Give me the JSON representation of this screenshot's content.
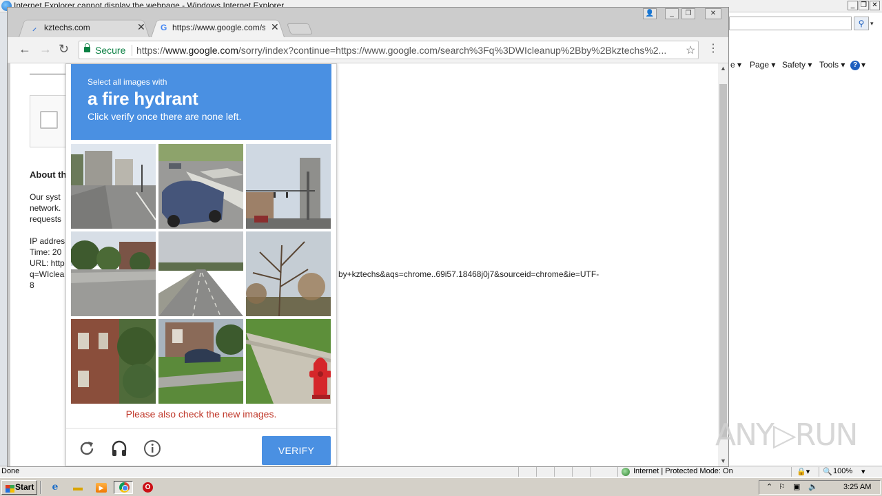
{
  "ie": {
    "title": "Internet Explorer cannot display the webpage - Windows Internet Explorer",
    "menu": {
      "page": "Page ▾",
      "safety": "Safety ▾",
      "tools": "Tools ▾",
      "help_glyph": "?"
    },
    "status": {
      "left": "Done",
      "zone": "Internet | Protected Mode: On",
      "zoom": "100%"
    }
  },
  "chrome": {
    "tabs": [
      {
        "label": "kztechs.com",
        "favicon": "feather-icon"
      },
      {
        "label": "https://www.google.com/se",
        "favicon": "google-g-icon"
      }
    ],
    "omnibox": {
      "secure": "Secure",
      "url_prefix": "https://",
      "url_host": "www.google.com",
      "url_rest": "/sorry/index?continue=https://www.google.com/search%3Fq%3DWIcleanup%2Bby%2Bkztechs%2..."
    }
  },
  "page": {
    "about_heading": "About th",
    "para_lines": [
      "Our syst",
      "network.",
      "requests"
    ],
    "info_lines": [
      "IP addres",
      "Time: 20",
      "URL: http",
      "q=WIclea",
      "8"
    ],
    "url_tail": "by+kztechs&aqs=chrome..69i57.18468j0j7&sourceid=chrome&ie=UTF-"
  },
  "captcha": {
    "instruction_top": "Select all images with",
    "object": "a fire hydrant",
    "instruction_bottom": "Click verify once there are none left.",
    "message": "Please also check the new images.",
    "verify_label": "VERIFY",
    "tiles": [
      "street-corner-buildings",
      "blue-car-crosswalk",
      "traffic-light-intersection",
      "trees-and-road",
      "highway-road",
      "bare-tree",
      "brick-house",
      "parked-car-lawn",
      "fire-hydrant-sidewalk"
    ],
    "colors": {
      "header": "#4a90e2",
      "message": "#c0392b"
    }
  },
  "taskbar": {
    "start": "Start",
    "clock": "3:25 AM"
  },
  "watermark": "ANY▷RUN"
}
